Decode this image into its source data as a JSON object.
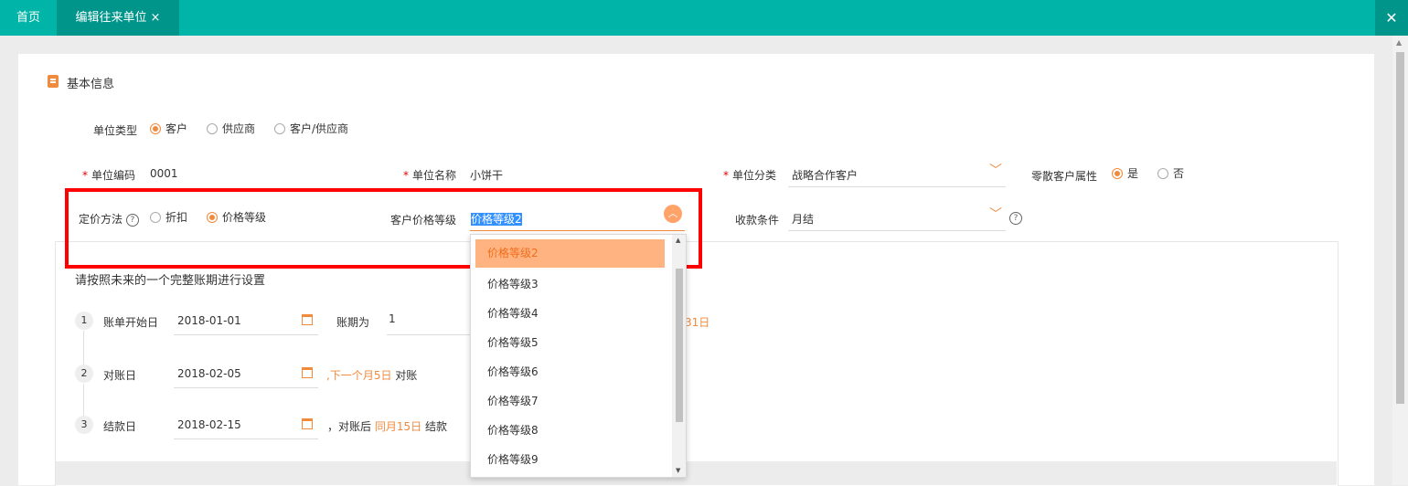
{
  "tabs": [
    {
      "label": "首页"
    },
    {
      "label": "编辑往来单位",
      "close": "×"
    }
  ],
  "window_close": "✕",
  "section_title": "基本信息",
  "unit_type": {
    "label": "单位类型",
    "options": [
      "客户",
      "供应商",
      "客户/供应商"
    ],
    "selected": "客户"
  },
  "unit_code": {
    "label": "单位编码",
    "value": "0001"
  },
  "unit_name": {
    "label": "单位名称",
    "value": "小饼干"
  },
  "unit_category": {
    "label": "单位分类",
    "value": "战略合作客户"
  },
  "retail_attr": {
    "label": "零散客户属性",
    "options": [
      "是",
      "否"
    ],
    "selected": "是"
  },
  "pricing_method": {
    "label": "定价方法",
    "options": [
      "折扣",
      "价格等级"
    ],
    "selected": "价格等级"
  },
  "customer_price_level": {
    "label": "客户价格等级",
    "value": "价格等级2"
  },
  "payment_terms": {
    "label": "收款条件",
    "value": "月结"
  },
  "price_levels": [
    "价格等级2",
    "价格等级3",
    "价格等级4",
    "价格等级5",
    "价格等级6",
    "价格等级7",
    "价格等级8",
    "价格等级9"
  ],
  "billing": {
    "instruction": "请按照未来的一个完整账期进行设置",
    "steps": [
      {
        "num": "1",
        "label": "账单开始日",
        "date": "2018-01-01"
      },
      {
        "num": "2",
        "label": "对账日",
        "date": "2018-02-05"
      },
      {
        "num": "3",
        "label": "结款日",
        "date": "2018-02-15"
      }
    ],
    "period_label": "账期为",
    "period_value": "1",
    "period_end_partial": "31日",
    "recon_note_highlight": ",下一个月5日",
    "recon_note_suffix": "对账",
    "settle_note_prefix": "，对账后",
    "settle_note_highlight": "同月15日",
    "settle_note_suffix": "结款"
  },
  "colors": {
    "accent": "#00b5a8",
    "orange": "#f08a3c",
    "highlight_box": "#ff0000"
  }
}
